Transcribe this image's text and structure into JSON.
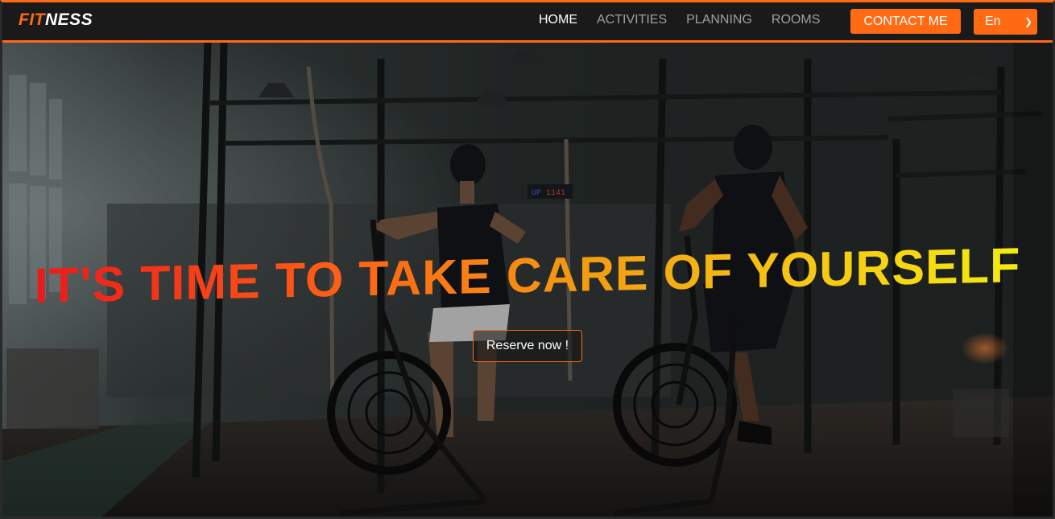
{
  "nav": {
    "logo_part1": "FIT",
    "logo_part2": "NESS",
    "links": [
      {
        "label": "HOME",
        "active": true
      },
      {
        "label": "ACTIVITIES",
        "active": false
      },
      {
        "label": "PLANNING",
        "active": false
      },
      {
        "label": "ROOMS",
        "active": false
      }
    ],
    "contact_label": "CONTACT ME",
    "language_selected": "En"
  },
  "hero": {
    "headline": "IT'S TIME TO TAKE CARE OF YOURSELF",
    "cta_label": "Reserve now !",
    "timer_text": "UP 1141"
  },
  "colors": {
    "accent": "#ff6a13",
    "navbar_bg": "#1a1a1a",
    "headline_gradient": [
      "#e8121c",
      "#ff5a16",
      "#f29b12",
      "#f6c414",
      "#f3f00f"
    ]
  },
  "icons": {
    "language_dropdown": "chevron-down-icon"
  }
}
